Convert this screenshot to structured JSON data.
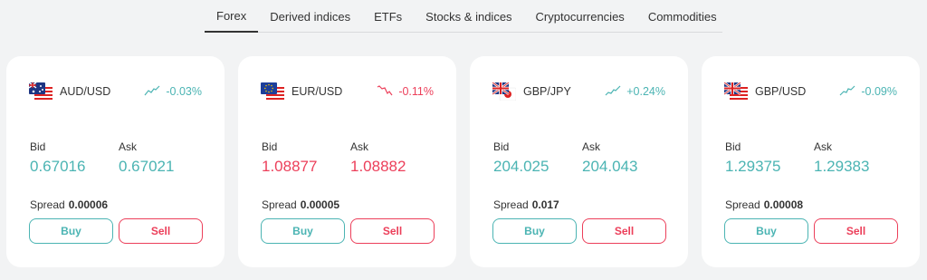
{
  "tabs": [
    "Forex",
    "Derived indices",
    "ETFs",
    "Stocks & indices",
    "Cryptocurrencies",
    "Commodities"
  ],
  "active_tab": "Forex",
  "labels": {
    "bid": "Bid",
    "ask": "Ask",
    "spread": "Spread",
    "buy": "Buy",
    "sell": "Sell"
  },
  "colors": {
    "up": "#4bb4b3",
    "down": "#ec3f5a",
    "text": "#333333",
    "background": "#f2f3f4"
  },
  "cards": [
    {
      "symbol": "AUD/USD",
      "flag": "aud-usd-flag-icon",
      "change": "-0.03%",
      "direction": "up",
      "bid": "0.67016",
      "ask": "0.67021",
      "spread": "0.00006"
    },
    {
      "symbol": "EUR/USD",
      "flag": "eur-usd-flag-icon",
      "change": "-0.11%",
      "direction": "down",
      "bid": "1.08877",
      "ask": "1.08882",
      "spread": "0.00005"
    },
    {
      "symbol": "GBP/JPY",
      "flag": "gbp-jpy-flag-icon",
      "change": "+0.24%",
      "direction": "up",
      "bid": "204.025",
      "ask": "204.043",
      "spread": "0.017"
    },
    {
      "symbol": "GBP/USD",
      "flag": "gbp-usd-flag-icon",
      "change": "-0.09%",
      "direction": "up",
      "bid": "1.29375",
      "ask": "1.29383",
      "spread": "0.00008"
    }
  ]
}
